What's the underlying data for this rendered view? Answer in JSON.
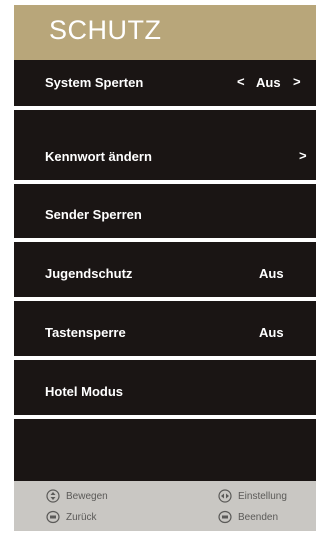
{
  "header": {
    "title": "SCHUTZ"
  },
  "menu": {
    "items": [
      {
        "label": "System Sperten",
        "value": "Aus",
        "left_arrow": "<",
        "right_arrow": ">"
      },
      {
        "label": "Kennwort ändern",
        "right_arrow": ">"
      },
      {
        "label": "Sender Sperren"
      },
      {
        "label": "Jugendschutz",
        "value": "Aus"
      },
      {
        "label": "Tastensperre",
        "value": "Aus"
      },
      {
        "label": "Hotel Modus"
      }
    ]
  },
  "footer": {
    "move": {
      "label": "Bewegen",
      "icon": "updown-icon"
    },
    "back": {
      "label": "Zurück",
      "icon": "menu-key-icon"
    },
    "setting": {
      "label": "Einstellung",
      "icon": "leftright-icon"
    },
    "exit": {
      "label": "Beenden",
      "icon": "exit-key-icon"
    }
  },
  "colors": {
    "header_bg": "#b8a67a",
    "panel_bg": "#1a1514",
    "footer_bg": "#c9c7c3",
    "text": "#ffffff",
    "footer_text": "#5b5a58"
  }
}
